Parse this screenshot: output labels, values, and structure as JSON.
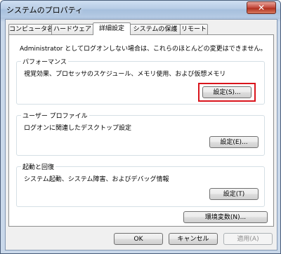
{
  "window": {
    "title": "システムのプロパティ",
    "close_glyph": "✕"
  },
  "tabs": [
    {
      "label": "コンピュータ名",
      "active": false
    },
    {
      "label": "ハードウェア",
      "active": false
    },
    {
      "label": "詳細設定",
      "active": true
    },
    {
      "label": "システムの保護",
      "active": false
    },
    {
      "label": "リモート",
      "active": false
    }
  ],
  "notice": "Administrator としてログオンしない場合は、これらのほとんどの変更はできません。",
  "performance": {
    "legend": "パフォーマンス",
    "description": "視覚効果、プロセッサのスケジュール、メモリ使用、および仮想メモリ",
    "button": "設定(S)..."
  },
  "user_profiles": {
    "legend": "ユーザー プロファイル",
    "description": "ログオンに関連したデスクトップ設定",
    "button": "設定(E)..."
  },
  "startup_recovery": {
    "legend": "起動と回復",
    "description": "システム起動、システム障害、およびデバッグ情報",
    "button": "設定(T)"
  },
  "env_vars_button": "環境変数(N)...",
  "footer": {
    "ok": "OK",
    "cancel": "キャンセル",
    "apply": "適用(A)"
  },
  "colors": {
    "highlight": "#d9141c",
    "close_button": "#c2473a"
  }
}
